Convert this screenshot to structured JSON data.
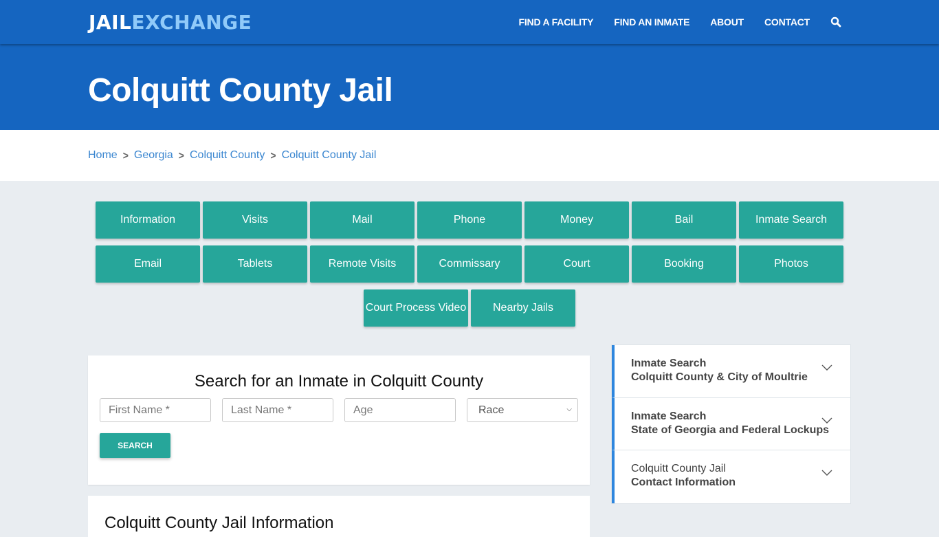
{
  "header": {
    "logo_part1": "JAIL",
    "logo_part2": "EXCHANGE",
    "nav": [
      "FIND A FACILITY",
      "FIND AN INMATE",
      "ABOUT",
      "CONTACT"
    ],
    "search_icon": "search-icon"
  },
  "hero": {
    "title": "Colquitt County Jail"
  },
  "breadcrumb": [
    "Home",
    "Georgia",
    "Colquitt County",
    "Colquitt County Jail"
  ],
  "tiles": [
    "Information",
    "Visits",
    "Mail",
    "Phone",
    "Money",
    "Bail",
    "Inmate Search",
    "Email",
    "Tablets",
    "Remote Visits",
    "Commissary",
    "Court",
    "Booking",
    "Photos",
    "Court Process Video",
    "Nearby Jails"
  ],
  "search": {
    "title": "Search for an Inmate in Colquitt County",
    "first_name_placeholder": "First Name *",
    "last_name_placeholder": "Last Name *",
    "age_placeholder": "Age",
    "race_selected": "Race",
    "button": "SEARCH"
  },
  "info": {
    "title": "Colquitt County Jail Information"
  },
  "accordion": [
    {
      "line1": "Inmate Search",
      "line2": "Colquitt County & City of Moultrie"
    },
    {
      "line1": "Inmate Search",
      "line2": "State of Georgia and Federal Lockups"
    },
    {
      "line1": "Colquitt County Jail",
      "line2": "Contact Information"
    }
  ],
  "colors": {
    "brand_blue": "#1565c0",
    "logo_light": "#90caf9",
    "teal": "#26a69a",
    "link": "#3a86d0"
  }
}
